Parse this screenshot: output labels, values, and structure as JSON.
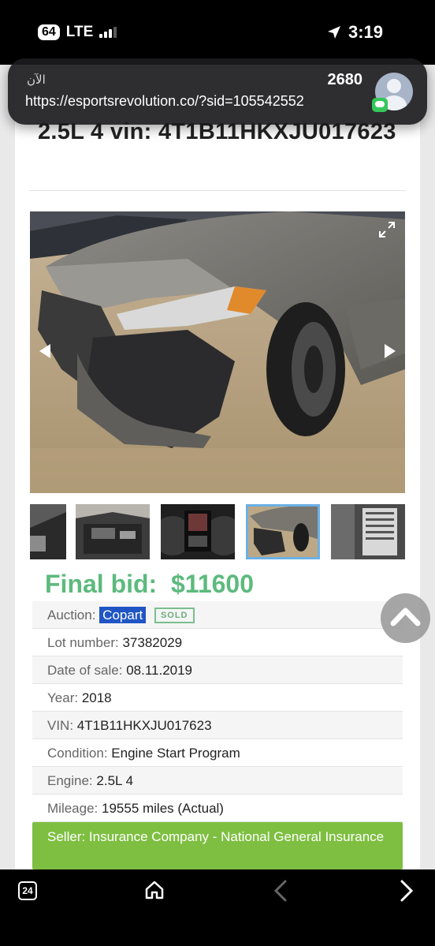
{
  "status_bar": {
    "battery": "64",
    "network": "LTE",
    "time": "3:19"
  },
  "notification": {
    "time": "الآن",
    "sender": "2680",
    "body": "https://esportsrevolution.co/?sid=105542552"
  },
  "listing": {
    "title": "2.5L 4 vin: 4T1B11HKXJU017623",
    "final_bid_label": "Final bid:",
    "final_bid_value": "$11600",
    "rows": [
      {
        "label": "Auction:",
        "value": "Copart",
        "badge": "SOLD"
      },
      {
        "label": "Lot number:",
        "value": "37382029"
      },
      {
        "label": "Date of sale:",
        "value": "08.11.2019"
      },
      {
        "label": "Year:",
        "value": "2018"
      },
      {
        "label": "VIN:",
        "value": "4T1B11HKXJU017623"
      },
      {
        "label": "Condition:",
        "value": "Engine Start Program"
      },
      {
        "label": "Engine:",
        "value": "2.5L 4"
      },
      {
        "label": "Mileage:",
        "value": "19555 miles (Actual)"
      }
    ],
    "seller": "Seller: Insurance Company - National General Insurance"
  },
  "bottom_bar": {
    "tab_count": "24"
  },
  "icons": {
    "location": "location-arrow-icon",
    "expand": "expand-icon",
    "home": "home-icon",
    "back": "chevron-left-icon",
    "forward": "chevron-right-icon",
    "scroll_top": "chevron-up-icon"
  },
  "colors": {
    "final_bid": "#5cba7d",
    "copart": "#1f55c4",
    "seller_bar": "#7ebf42",
    "sold_badge": "#7bbf8e"
  }
}
